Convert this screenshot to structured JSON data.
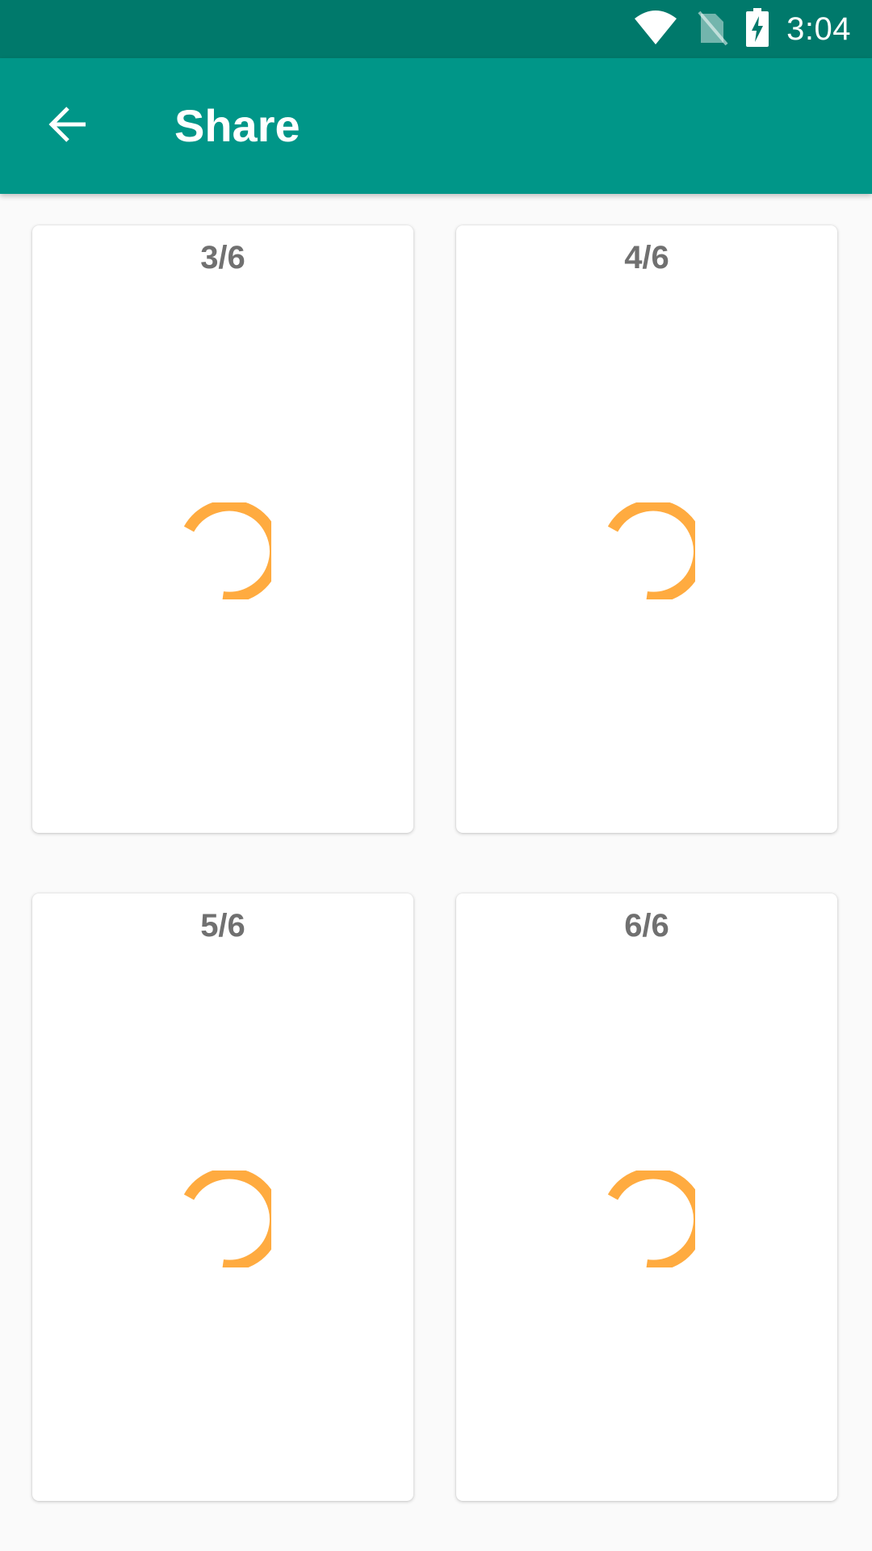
{
  "status_bar": {
    "time": "3:04",
    "icons": [
      "wifi-icon",
      "no-sim-icon",
      "battery-charging-icon"
    ],
    "background": "#00796b"
  },
  "app_bar": {
    "title": "Share",
    "back_icon": "arrow-back-icon",
    "background": "#009688"
  },
  "pages": [
    {
      "label": "3/6"
    },
    {
      "label": "4/6"
    },
    {
      "label": "5/6"
    },
    {
      "label": "6/6"
    }
  ],
  "colors": {
    "spinner": "#ffab40",
    "label": "#707070",
    "card": "#ffffff",
    "background": "#fafafa"
  }
}
